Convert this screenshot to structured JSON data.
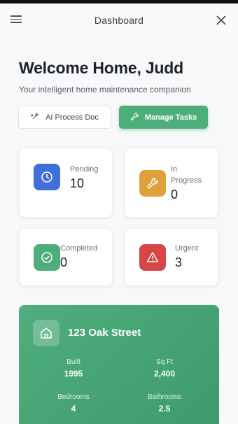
{
  "appbar": {
    "title": "Dashboard"
  },
  "hero": {
    "title": "Welcome Home, Judd",
    "subtitle": "Your intelligent home maintenance companion"
  },
  "actions": {
    "ai_process": "AI Process Doc",
    "manage_tasks": "Manage Tasks"
  },
  "stats": {
    "pending": {
      "label": "Pending",
      "value": "10",
      "color": "#3f6fd8",
      "icon": "clock-icon"
    },
    "in_progress": {
      "label_line1": "In",
      "label_line2": "Progress",
      "value": "0",
      "color": "#dfa13a",
      "icon": "wrench-icon"
    },
    "completed": {
      "label": "Completed",
      "value": "0",
      "color": "#4caf7a",
      "icon": "check-circle-icon"
    },
    "urgent": {
      "label": "Urgent",
      "value": "3",
      "color": "#d84545",
      "icon": "warning-icon"
    }
  },
  "property": {
    "address": "123 Oak Street",
    "built_label": "Built",
    "built": "1995",
    "sqft_label": "Sq Ft",
    "sqft": "2,400",
    "bedrooms_label": "Bedrooms",
    "bedrooms": "4",
    "bathrooms_label": "Bathrooms",
    "bathrooms": "2.5",
    "icon": "home-icon"
  },
  "colors": {
    "accent": "#4caf7a",
    "background": "#f7f8f9"
  }
}
